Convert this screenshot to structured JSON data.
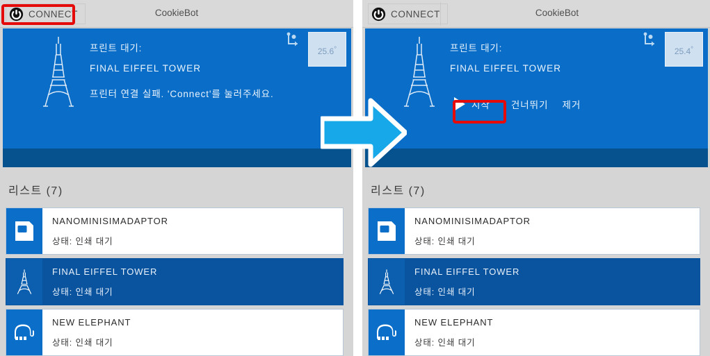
{
  "meta": {
    "accent_blue": "#0a6ec8",
    "selected_blue": "#0a539e",
    "band_blue": "#05528f",
    "annotation_red": "#e60b0b",
    "arrow_cyan": "#16a8e8",
    "chrome_gray": "#d9d9d9"
  },
  "panels": [
    {
      "id": "before",
      "titlebar": {
        "connect_label": "CONNECT",
        "power_icon": "power-icon",
        "app_title": "CookieBot"
      },
      "hero": {
        "artwork_icon": "eiffel-tower-icon",
        "line1": "프린트 대기:",
        "line2": "FINAL EIFFEL TOWER",
        "line3": "프린터 연결 실패. 'Connect'를 눌러주세요.",
        "rotate_icon": "rotate-axis-icon",
        "temperature": "25.6",
        "temperature_unit": "°",
        "has_actions": false
      },
      "list": {
        "title": "리스트 (7)",
        "items": [
          {
            "icon": "sim-adaptor-icon",
            "name": "NANOMINISIMADAPTOR",
            "status": "상태: 인쇄 대기",
            "selected": false
          },
          {
            "icon": "eiffel-tower-icon",
            "name": "FINAL EIFFEL TOWER",
            "status": "상태: 인쇄 대기",
            "selected": true
          },
          {
            "icon": "elephant-icon",
            "name": "NEW ELEPHANT",
            "status": "상태: 인쇄 대기",
            "selected": false
          }
        ]
      },
      "annotation": {
        "target": "connect-button"
      }
    },
    {
      "id": "after",
      "titlebar": {
        "connect_label": "CONNECT",
        "power_icon": "power-icon",
        "app_title": "CookieBot"
      },
      "hero": {
        "artwork_icon": "eiffel-tower-icon",
        "line1": "프린트 대기:",
        "line2": "FINAL EIFFEL TOWER",
        "line3": "",
        "rotate_icon": "rotate-axis-icon",
        "temperature": "25.4",
        "temperature_unit": "°",
        "has_actions": true,
        "actions": [
          {
            "icon": "play-icon",
            "label": "시작"
          },
          {
            "icon": "",
            "label": "건너뛰기"
          },
          {
            "icon": "",
            "label": "제거"
          }
        ]
      },
      "list": {
        "title": "리스트 (7)",
        "items": [
          {
            "icon": "sim-adaptor-icon",
            "name": "NANOMINISIMADAPTOR",
            "status": "상태: 인쇄 대기",
            "selected": false
          },
          {
            "icon": "eiffel-tower-icon",
            "name": "FINAL EIFFEL TOWER",
            "status": "상태: 인쇄 대기",
            "selected": true
          },
          {
            "icon": "elephant-icon",
            "name": "NEW ELEPHANT",
            "status": "상태: 인쇄 대기",
            "selected": false
          }
        ]
      },
      "annotation": {
        "target": "start-button"
      }
    }
  ],
  "transition": {
    "icon": "right-arrow-icon"
  }
}
